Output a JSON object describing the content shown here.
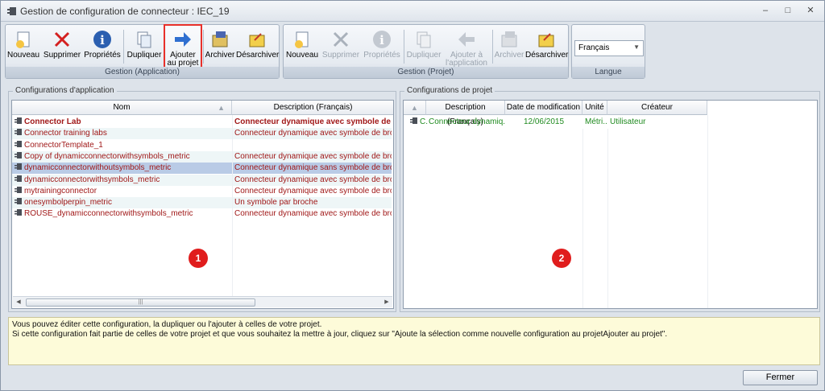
{
  "window": {
    "title": "Gestion de configuration de connecteur : IEC_19"
  },
  "ribbon": {
    "application": {
      "label": "Gestion (Application)",
      "buttons": [
        {
          "label": "Nouveau",
          "icon": "new-doc-icon"
        },
        {
          "label": "Supprimer",
          "icon": "delete-x-icon"
        },
        {
          "label": "Propriétés",
          "icon": "info-icon"
        },
        {
          "label": "Dupliquer",
          "icon": "duplicate-icon"
        },
        {
          "label1": "Ajouter",
          "label2": "au projet",
          "icon": "arrow-right-icon"
        },
        {
          "label": "Archiver",
          "icon": "archive-icon"
        },
        {
          "label": "Désarchiver",
          "icon": "unarchive-icon"
        }
      ]
    },
    "project": {
      "label": "Gestion (Projet)",
      "buttons": [
        {
          "label": "Nouveau",
          "icon": "new-doc-icon"
        },
        {
          "label": "Supprimer",
          "icon": "delete-x-icon"
        },
        {
          "label": "Propriétés",
          "icon": "info-icon"
        },
        {
          "label": "Dupliquer",
          "icon": "duplicate-icon"
        },
        {
          "label1": "Ajouter à",
          "label2": "l'application",
          "icon": "arrow-left-icon"
        },
        {
          "label": "Archiver",
          "icon": "archive-icon"
        },
        {
          "label": "Désarchiver",
          "icon": "unarchive-icon"
        }
      ]
    },
    "language": {
      "label": "Langue",
      "value": "Français"
    }
  },
  "app_configs": {
    "title": "Configurations d'application",
    "columns": [
      "Nom",
      "Description (Français)"
    ],
    "rows": [
      {
        "name": "Connector Lab",
        "desc": "Connecteur dynamique avec symbole de b"
      },
      {
        "name": "Connector training labs",
        "desc": "Connecteur dynamique avec symbole de broche"
      },
      {
        "name": "ConnectorTemplate_1",
        "desc": ""
      },
      {
        "name": "Copy of dynamicconnectorwithsymbols_metric",
        "desc": "Connecteur dynamique avec symbole de broche"
      },
      {
        "name": "dynamicconnectorwithoutsymbols_metric",
        "desc": "Connecteur dynamique sans symbole de broche"
      },
      {
        "name": "dynamicconnectorwithsymbols_metric",
        "desc": "Connecteur dynamique avec symbole de broche"
      },
      {
        "name": "mytrainingconnector",
        "desc": "Connecteur dynamique avec symbole de broche"
      },
      {
        "name": "onesymbolperpin_metric",
        "desc": "Un symbole par broche"
      },
      {
        "name": "ROUSE_dynamicconnectorwithsymbols_metric",
        "desc": "Connecteur dynamique avec symbole de broche"
      }
    ],
    "badge": "1"
  },
  "project_configs": {
    "title": "Configurations de projet",
    "columns": [
      "",
      "Description (Français)",
      "Date de modification",
      "Unité",
      "Créateur"
    ],
    "rows": [
      {
        "name": "C.",
        "desc": "Connecteur dynamiq...",
        "date": "12/06/2015",
        "unit": "Métri...",
        "creator": "Utilisateur"
      }
    ],
    "badge": "2"
  },
  "info": {
    "line1": "Vous pouvez éditer cette configuration, la dupliquer ou l'ajouter à celles de votre projet.",
    "line2": "Si cette configuration fait partie de celles de votre projet et que vous souhaitez la mettre à jour, cliquez sur \"Ajoute la sélection comme nouvelle configuration au projetAjouter au projet\"."
  },
  "footer": {
    "close_label": "Fermer"
  }
}
